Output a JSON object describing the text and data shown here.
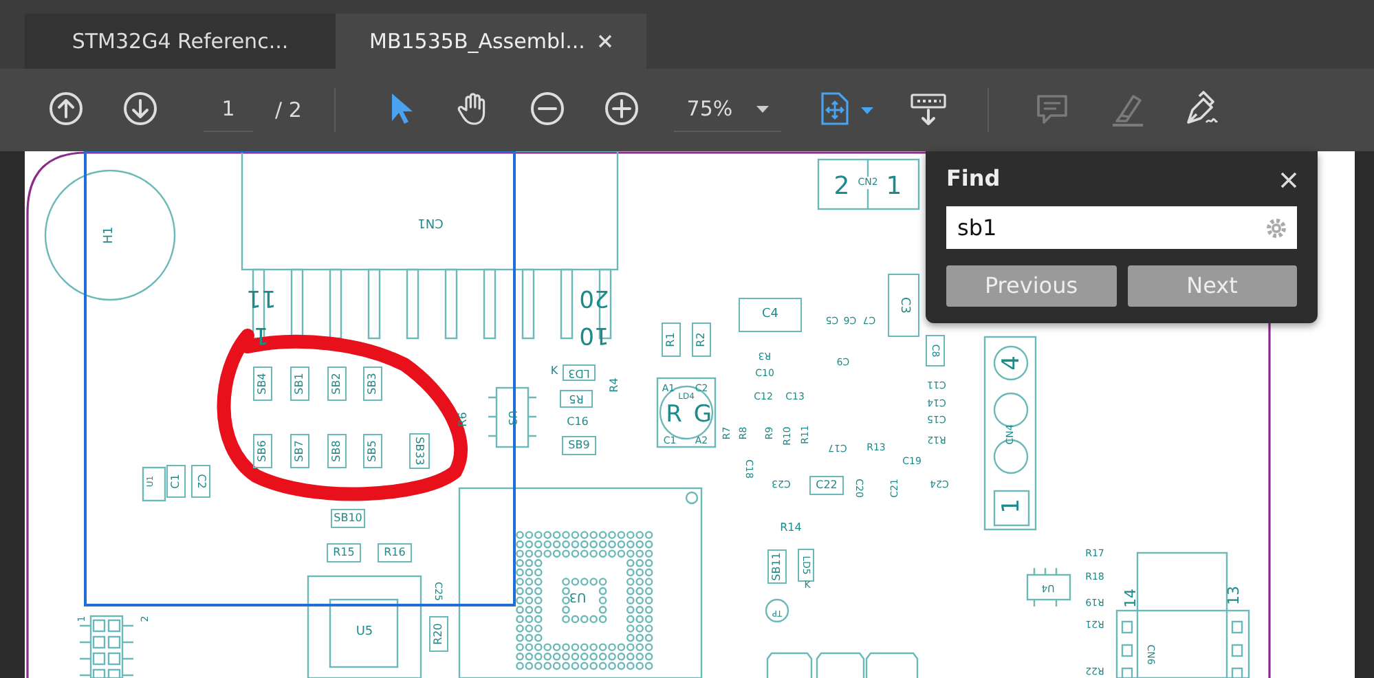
{
  "tabs": [
    {
      "label": "STM32G4 Referenc...",
      "selected": false,
      "closable": false
    },
    {
      "label": "MB1535B_Assembl...",
      "selected": true,
      "closable": true
    }
  ],
  "toolbar": {
    "page_field": "1",
    "page_total": "/ 2",
    "zoom": "75%",
    "tools": [
      {
        "kind": "page-up",
        "active": false,
        "disabled": false
      },
      {
        "kind": "page-down",
        "active": false,
        "disabled": false
      },
      {
        "kind": "select",
        "active": true,
        "disabled": false
      },
      {
        "kind": "hand",
        "active": false,
        "disabled": false
      },
      {
        "kind": "zoom-out",
        "active": false,
        "disabled": false
      },
      {
        "kind": "zoom-in",
        "active": false,
        "disabled": false
      },
      {
        "kind": "fit",
        "active": true,
        "disabled": false
      },
      {
        "kind": "keyboard",
        "active": false,
        "disabled": false
      },
      {
        "kind": "comment",
        "active": false,
        "disabled": true
      },
      {
        "kind": "highlight",
        "active": false,
        "disabled": true
      },
      {
        "kind": "sign",
        "active": false,
        "disabled": false
      }
    ]
  },
  "find": {
    "title": "Find",
    "query": "sb1",
    "buttons": [
      "Previous",
      "Next"
    ]
  },
  "document": {
    "labels": [
      {
        "label": "H1"
      },
      {
        "label": "CN1"
      },
      {
        "label": "11"
      },
      {
        "label": "1"
      },
      {
        "label": "20"
      },
      {
        "label": "10"
      },
      {
        "label": "SB4"
      },
      {
        "label": "SB1"
      },
      {
        "label": "SB2"
      },
      {
        "label": "SB3"
      },
      {
        "label": "SB6"
      },
      {
        "label": "SB7"
      },
      {
        "label": "SB8"
      },
      {
        "label": "SB5"
      },
      {
        "label": "SB33"
      },
      {
        "label": "R6"
      },
      {
        "label": "U3"
      },
      {
        "label": "LD3"
      },
      {
        "label": "K"
      },
      {
        "label": "R5"
      },
      {
        "label": "C16"
      },
      {
        "label": "SB9"
      },
      {
        "label": "R4"
      },
      {
        "label": "R1"
      },
      {
        "label": "R2"
      },
      {
        "label": "C4"
      },
      {
        "label": "C3"
      },
      {
        "label": "2"
      },
      {
        "label": "CN2"
      },
      {
        "label": "1"
      },
      {
        "label": "C5"
      },
      {
        "label": "C6"
      },
      {
        "label": "C7"
      },
      {
        "label": "R3"
      },
      {
        "label": "C9"
      },
      {
        "label": "C10"
      },
      {
        "label": "C12"
      },
      {
        "label": "C13"
      },
      {
        "label": "C8"
      },
      {
        "label": "C11"
      },
      {
        "label": "C14"
      },
      {
        "label": "C15"
      },
      {
        "label": "R12"
      },
      {
        "label": "R"
      },
      {
        "label": "G"
      },
      {
        "label": "A1"
      },
      {
        "label": "C2"
      },
      {
        "label": "C1"
      },
      {
        "label": "A2"
      },
      {
        "label": "LD4"
      },
      {
        "label": "R7"
      },
      {
        "label": "R8"
      },
      {
        "label": "R9"
      },
      {
        "label": "R10"
      },
      {
        "label": "R11"
      },
      {
        "label": "C17"
      },
      {
        "label": "R13"
      },
      {
        "label": "C19"
      },
      {
        "label": "C18"
      },
      {
        "label": "C23"
      },
      {
        "label": "C22"
      },
      {
        "label": "C20"
      },
      {
        "label": "C21"
      },
      {
        "label": "C24"
      },
      {
        "label": "R14"
      },
      {
        "label": "SB11"
      },
      {
        "label": "LD5"
      },
      {
        "label": "K"
      },
      {
        "label": "TP"
      },
      {
        "label": "U3"
      },
      {
        "label": "SB10"
      },
      {
        "label": "R15"
      },
      {
        "label": "R16"
      },
      {
        "label": "C25"
      },
      {
        "label": "R20"
      },
      {
        "label": "U5"
      },
      {
        "label": "U1"
      },
      {
        "label": "C1"
      },
      {
        "label": "C2"
      },
      {
        "label": "CN4"
      },
      {
        "label": "4"
      },
      {
        "label": "1"
      },
      {
        "label": "U4"
      },
      {
        "label": "R17"
      },
      {
        "label": "R18"
      },
      {
        "label": "R19"
      },
      {
        "label": "R21"
      },
      {
        "label": "R22"
      },
      {
        "label": "14"
      },
      {
        "label": "13"
      },
      {
        "label": "CN6"
      },
      {
        "label": "1"
      },
      {
        "label": "2"
      }
    ]
  }
}
